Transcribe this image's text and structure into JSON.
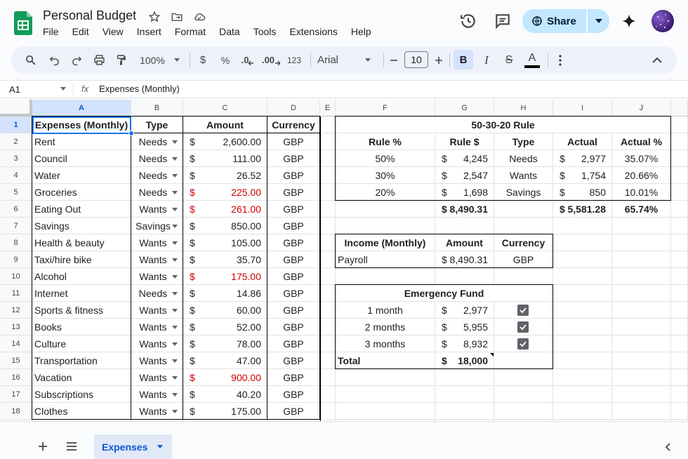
{
  "doc": {
    "title": "Personal Budget"
  },
  "menus": [
    "File",
    "Edit",
    "View",
    "Insert",
    "Format",
    "Data",
    "Tools",
    "Extensions",
    "Help"
  ],
  "share_label": "Share",
  "toolbar": {
    "zoom": "100%",
    "currency": "$",
    "percent": "%",
    "dec_less": ".0",
    "dec_more": ".00",
    "number_format": "123",
    "font": "Arial",
    "font_size": "10",
    "bold": "B",
    "italic": "I",
    "strike": "S",
    "text_color": "A",
    "text_color_value": "#000000"
  },
  "formula_bar": {
    "name_box": "A1",
    "fx": "fx",
    "formula": "Expenses (Monthly)"
  },
  "columns": [
    "A",
    "B",
    "C",
    "D",
    "E",
    "F",
    "G",
    "H",
    "I",
    "J"
  ],
  "rows": [
    "1",
    "2",
    "3",
    "4",
    "5",
    "6",
    "7",
    "8",
    "9",
    "10",
    "11",
    "12",
    "13",
    "14",
    "15",
    "16",
    "17",
    "18"
  ],
  "expenses": {
    "headers": [
      "Expenses (Monthly)",
      "Type",
      "Amount",
      "Currency"
    ],
    "items": [
      {
        "name": "Rent",
        "type": "Needs",
        "amount": "2,600.00",
        "currency": "GBP",
        "over": false
      },
      {
        "name": "Council",
        "type": "Needs",
        "amount": "111.00",
        "currency": "GBP",
        "over": false
      },
      {
        "name": "Water",
        "type": "Needs",
        "amount": "26.52",
        "currency": "GBP",
        "over": false
      },
      {
        "name": "Groceries",
        "type": "Needs",
        "amount": "225.00",
        "currency": "GBP",
        "over": true
      },
      {
        "name": "Eating Out",
        "type": "Wants",
        "amount": "261.00",
        "currency": "GBP",
        "over": true
      },
      {
        "name": "Savings",
        "type": "Savings",
        "amount": "850.00",
        "currency": "GBP",
        "over": false
      },
      {
        "name": "Health & beauty",
        "type": "Wants",
        "amount": "105.00",
        "currency": "GBP",
        "over": false
      },
      {
        "name": "Taxi/hire bike",
        "type": "Wants",
        "amount": "35.70",
        "currency": "GBP",
        "over": false
      },
      {
        "name": "Alcohol",
        "type": "Wants",
        "amount": "175.00",
        "currency": "GBP",
        "over": true
      },
      {
        "name": "Internet",
        "type": "Needs",
        "amount": "14.86",
        "currency": "GBP",
        "over": false
      },
      {
        "name": "Sports & fitness",
        "type": "Wants",
        "amount": "60.00",
        "currency": "GBP",
        "over": false
      },
      {
        "name": "Books",
        "type": "Wants",
        "amount": "52.00",
        "currency": "GBP",
        "over": false
      },
      {
        "name": "Culture",
        "type": "Wants",
        "amount": "78.00",
        "currency": "GBP",
        "over": false
      },
      {
        "name": "Transportation",
        "type": "Wants",
        "amount": "47.00",
        "currency": "GBP",
        "over": false
      },
      {
        "name": "Vacation",
        "type": "Wants",
        "amount": "900.00",
        "currency": "GBP",
        "over": true
      },
      {
        "name": "Subscriptions",
        "type": "Wants",
        "amount": "40.20",
        "currency": "GBP",
        "over": false
      },
      {
        "name": "Clothes",
        "type": "Wants",
        "amount": "175.00",
        "currency": "GBP",
        "over": false
      }
    ]
  },
  "rule": {
    "title": "50-30-20 Rule",
    "headers": [
      "Rule %",
      "Rule $",
      "Type",
      "Actual",
      "Actual %"
    ],
    "rows": [
      {
        "pct": "50%",
        "rule": "4,245",
        "type": "Needs",
        "actual": "2,977",
        "actual_pct": "35.07%"
      },
      {
        "pct": "30%",
        "rule": "2,547",
        "type": "Wants",
        "actual": "1,754",
        "actual_pct": "20.66%"
      },
      {
        "pct": "20%",
        "rule": "1,698",
        "type": "Savings",
        "actual": "850",
        "actual_pct": "10.01%"
      }
    ],
    "total_rule": "8,490.31",
    "total_actual": "5,581.28",
    "total_pct": "65.74%"
  },
  "income": {
    "headers": [
      "Income (Monthly)",
      "Amount",
      "Currency"
    ],
    "name": "Payroll",
    "amount": "8,490.31",
    "currency": "GBP"
  },
  "emergency": {
    "title": "Emergency Fund",
    "rows": [
      {
        "label": "1 month",
        "amount": "2,977",
        "checked": true
      },
      {
        "label": "2 months",
        "amount": "5,955",
        "checked": true
      },
      {
        "label": "3 months",
        "amount": "8,932",
        "checked": true
      }
    ],
    "total_label": "Total",
    "total": "18,000"
  },
  "currency_symbol": "$",
  "sheet_tab": "Expenses",
  "colors": {
    "accent": "#0b57d0",
    "share_bg": "#c2e7ff",
    "over_budget": "#cc0000",
    "selection": "#1a73e8"
  }
}
